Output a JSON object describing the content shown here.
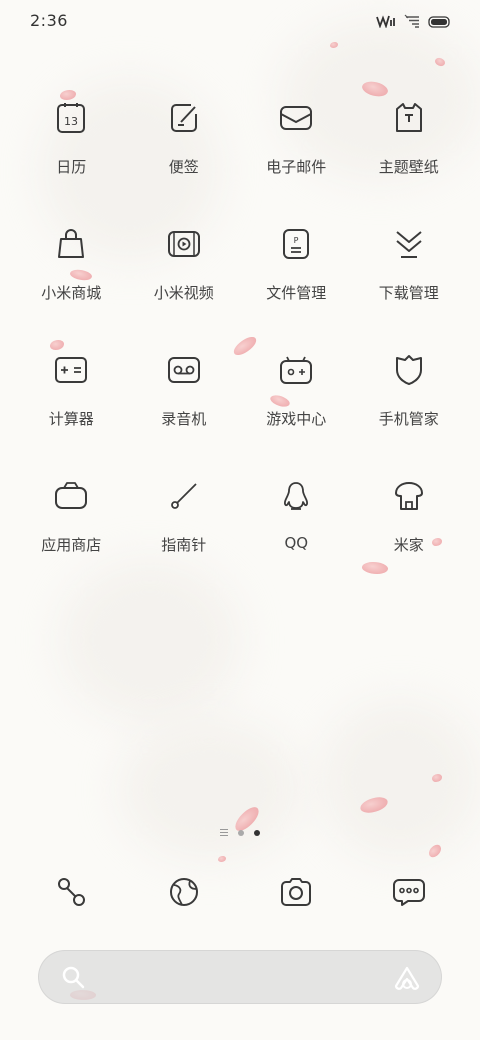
{
  "status_bar": {
    "time": "2:36",
    "icons": [
      "signal-icon",
      "wifi-icon",
      "battery-icon"
    ]
  },
  "apps": [
    [
      {
        "name": "calendar",
        "label": "日历",
        "icon": "calendar-icon",
        "day": "13"
      },
      {
        "name": "notes",
        "label": "便签",
        "icon": "notes-icon"
      },
      {
        "name": "email",
        "label": "电子邮件",
        "icon": "email-icon"
      },
      {
        "name": "themes",
        "label": "主题壁纸",
        "icon": "themes-icon"
      }
    ],
    [
      {
        "name": "mi-store",
        "label": "小米商城",
        "icon": "shopping-bag-icon"
      },
      {
        "name": "mi-video",
        "label": "小米视频",
        "icon": "video-icon"
      },
      {
        "name": "file-manager",
        "label": "文件管理",
        "icon": "file-icon"
      },
      {
        "name": "downloads",
        "label": "下载管理",
        "icon": "download-icon"
      }
    ],
    [
      {
        "name": "calculator",
        "label": "计算器",
        "icon": "calculator-icon"
      },
      {
        "name": "recorder",
        "label": "录音机",
        "icon": "recorder-icon"
      },
      {
        "name": "game-center",
        "label": "游戏中心",
        "icon": "gamepad-icon"
      },
      {
        "name": "security",
        "label": "手机管家",
        "icon": "shield-icon"
      }
    ],
    [
      {
        "name": "app-store",
        "label": "应用商店",
        "icon": "store-bag-icon"
      },
      {
        "name": "compass",
        "label": "指南针",
        "icon": "compass-icon"
      },
      {
        "name": "qq",
        "label": "QQ",
        "icon": "penguin-icon"
      },
      {
        "name": "mi-home",
        "label": "米家",
        "icon": "mi-home-icon"
      }
    ]
  ],
  "page_indicator": {
    "pages": 2,
    "active": 2
  },
  "dock": [
    {
      "name": "phone",
      "icon": "phone-icon"
    },
    {
      "name": "browser",
      "icon": "browser-icon"
    },
    {
      "name": "camera",
      "icon": "camera-icon"
    },
    {
      "name": "messages",
      "icon": "messages-icon"
    }
  ],
  "search": {
    "icon": "search-icon",
    "assist_icon": "assistant-icon"
  },
  "colors": {
    "icon_stroke": "#3a3a3a",
    "background": "#fbfaf7",
    "petal": "#eea3a6"
  }
}
